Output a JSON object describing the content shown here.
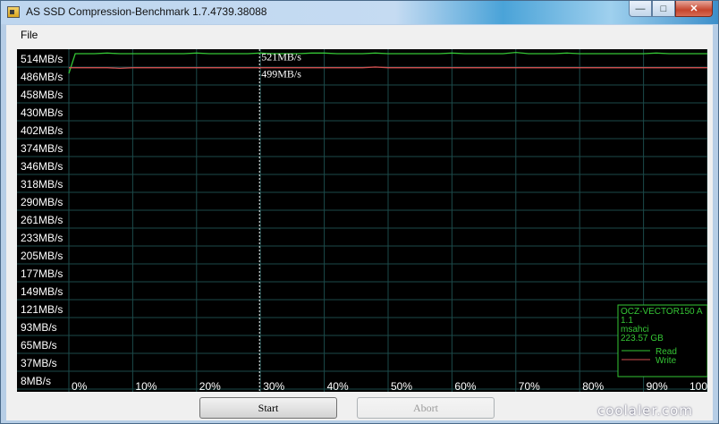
{
  "window": {
    "title": "AS SSD Compression-Benchmark 1.7.4739.38088"
  },
  "menu": {
    "file": "File"
  },
  "chart_data": {
    "type": "line",
    "y_ticks": [
      "514MB/s",
      "486MB/s",
      "458MB/s",
      "430MB/s",
      "402MB/s",
      "374MB/s",
      "346MB/s",
      "318MB/s",
      "290MB/s",
      "261MB/s",
      "233MB/s",
      "205MB/s",
      "177MB/s",
      "149MB/s",
      "121MB/s",
      "93MB/s",
      "65MB/s",
      "37MB/s",
      "8MB/s"
    ],
    "x_ticks": [
      "0%",
      "10%",
      "20%",
      "30%",
      "40%",
      "50%",
      "60%",
      "70%",
      "80%",
      "90%",
      "100%"
    ],
    "ylim": [
      8,
      514
    ],
    "cursor_x": 30,
    "annotations": {
      "read": "521MB/s",
      "write": "499MB/s"
    },
    "series": [
      {
        "name": "Read",
        "color": "#35c635",
        "x": [
          0,
          1,
          2,
          4,
          6,
          8,
          10,
          12,
          14,
          16,
          18,
          20,
          22,
          24,
          26,
          28,
          30,
          32,
          34,
          36,
          38,
          40,
          42,
          44,
          46,
          48,
          50,
          52,
          54,
          56,
          58,
          60,
          62,
          64,
          66,
          68,
          70,
          72,
          74,
          76,
          78,
          80,
          82,
          84,
          86,
          88,
          90,
          92,
          94,
          96,
          98,
          100
        ],
        "values": [
          490,
          521,
          521,
          521,
          522,
          521,
          521,
          521,
          521,
          521,
          521,
          522,
          521,
          521,
          521,
          521,
          522,
          521,
          521,
          521,
          522,
          522,
          521,
          521,
          521,
          522,
          521,
          521,
          521,
          521,
          521,
          522,
          521,
          521,
          521,
          521,
          523,
          521,
          521,
          521,
          522,
          521,
          521,
          521,
          521,
          521,
          521,
          522,
          521,
          521,
          521,
          521
        ]
      },
      {
        "name": "Write",
        "color": "#d05050",
        "x": [
          0,
          1,
          2,
          4,
          6,
          8,
          10,
          12,
          14,
          16,
          18,
          20,
          22,
          24,
          26,
          28,
          30,
          32,
          34,
          36,
          38,
          40,
          42,
          44,
          46,
          48,
          50,
          52,
          54,
          56,
          58,
          60,
          62,
          64,
          66,
          68,
          70,
          72,
          74,
          76,
          78,
          80,
          82,
          84,
          86,
          88,
          90,
          92,
          94,
          96,
          98,
          100
        ],
        "values": [
          499,
          499,
          499,
          499,
          499,
          498,
          499,
          499,
          499,
          499,
          499,
          499,
          499,
          499,
          499,
          499,
          499,
          499,
          499,
          499,
          499,
          499,
          499,
          499,
          499,
          500,
          499,
          499,
          499,
          499,
          499,
          499,
          499,
          499,
          499,
          499,
          499,
          499,
          499,
          499,
          499,
          499,
          499,
          499,
          499,
          499,
          499,
          499,
          499,
          499,
          499,
          499
        ]
      }
    ],
    "legend": {
      "position": "bottom-right",
      "lines": [
        "OCZ-VECTOR150 A",
        "1.1",
        "msahci",
        "223.57 GB"
      ],
      "read_label": "Read",
      "write_label": "Write"
    },
    "grid": true
  },
  "buttons": {
    "start": "Start",
    "abort": "Abort"
  },
  "watermark": "coolaler.com"
}
